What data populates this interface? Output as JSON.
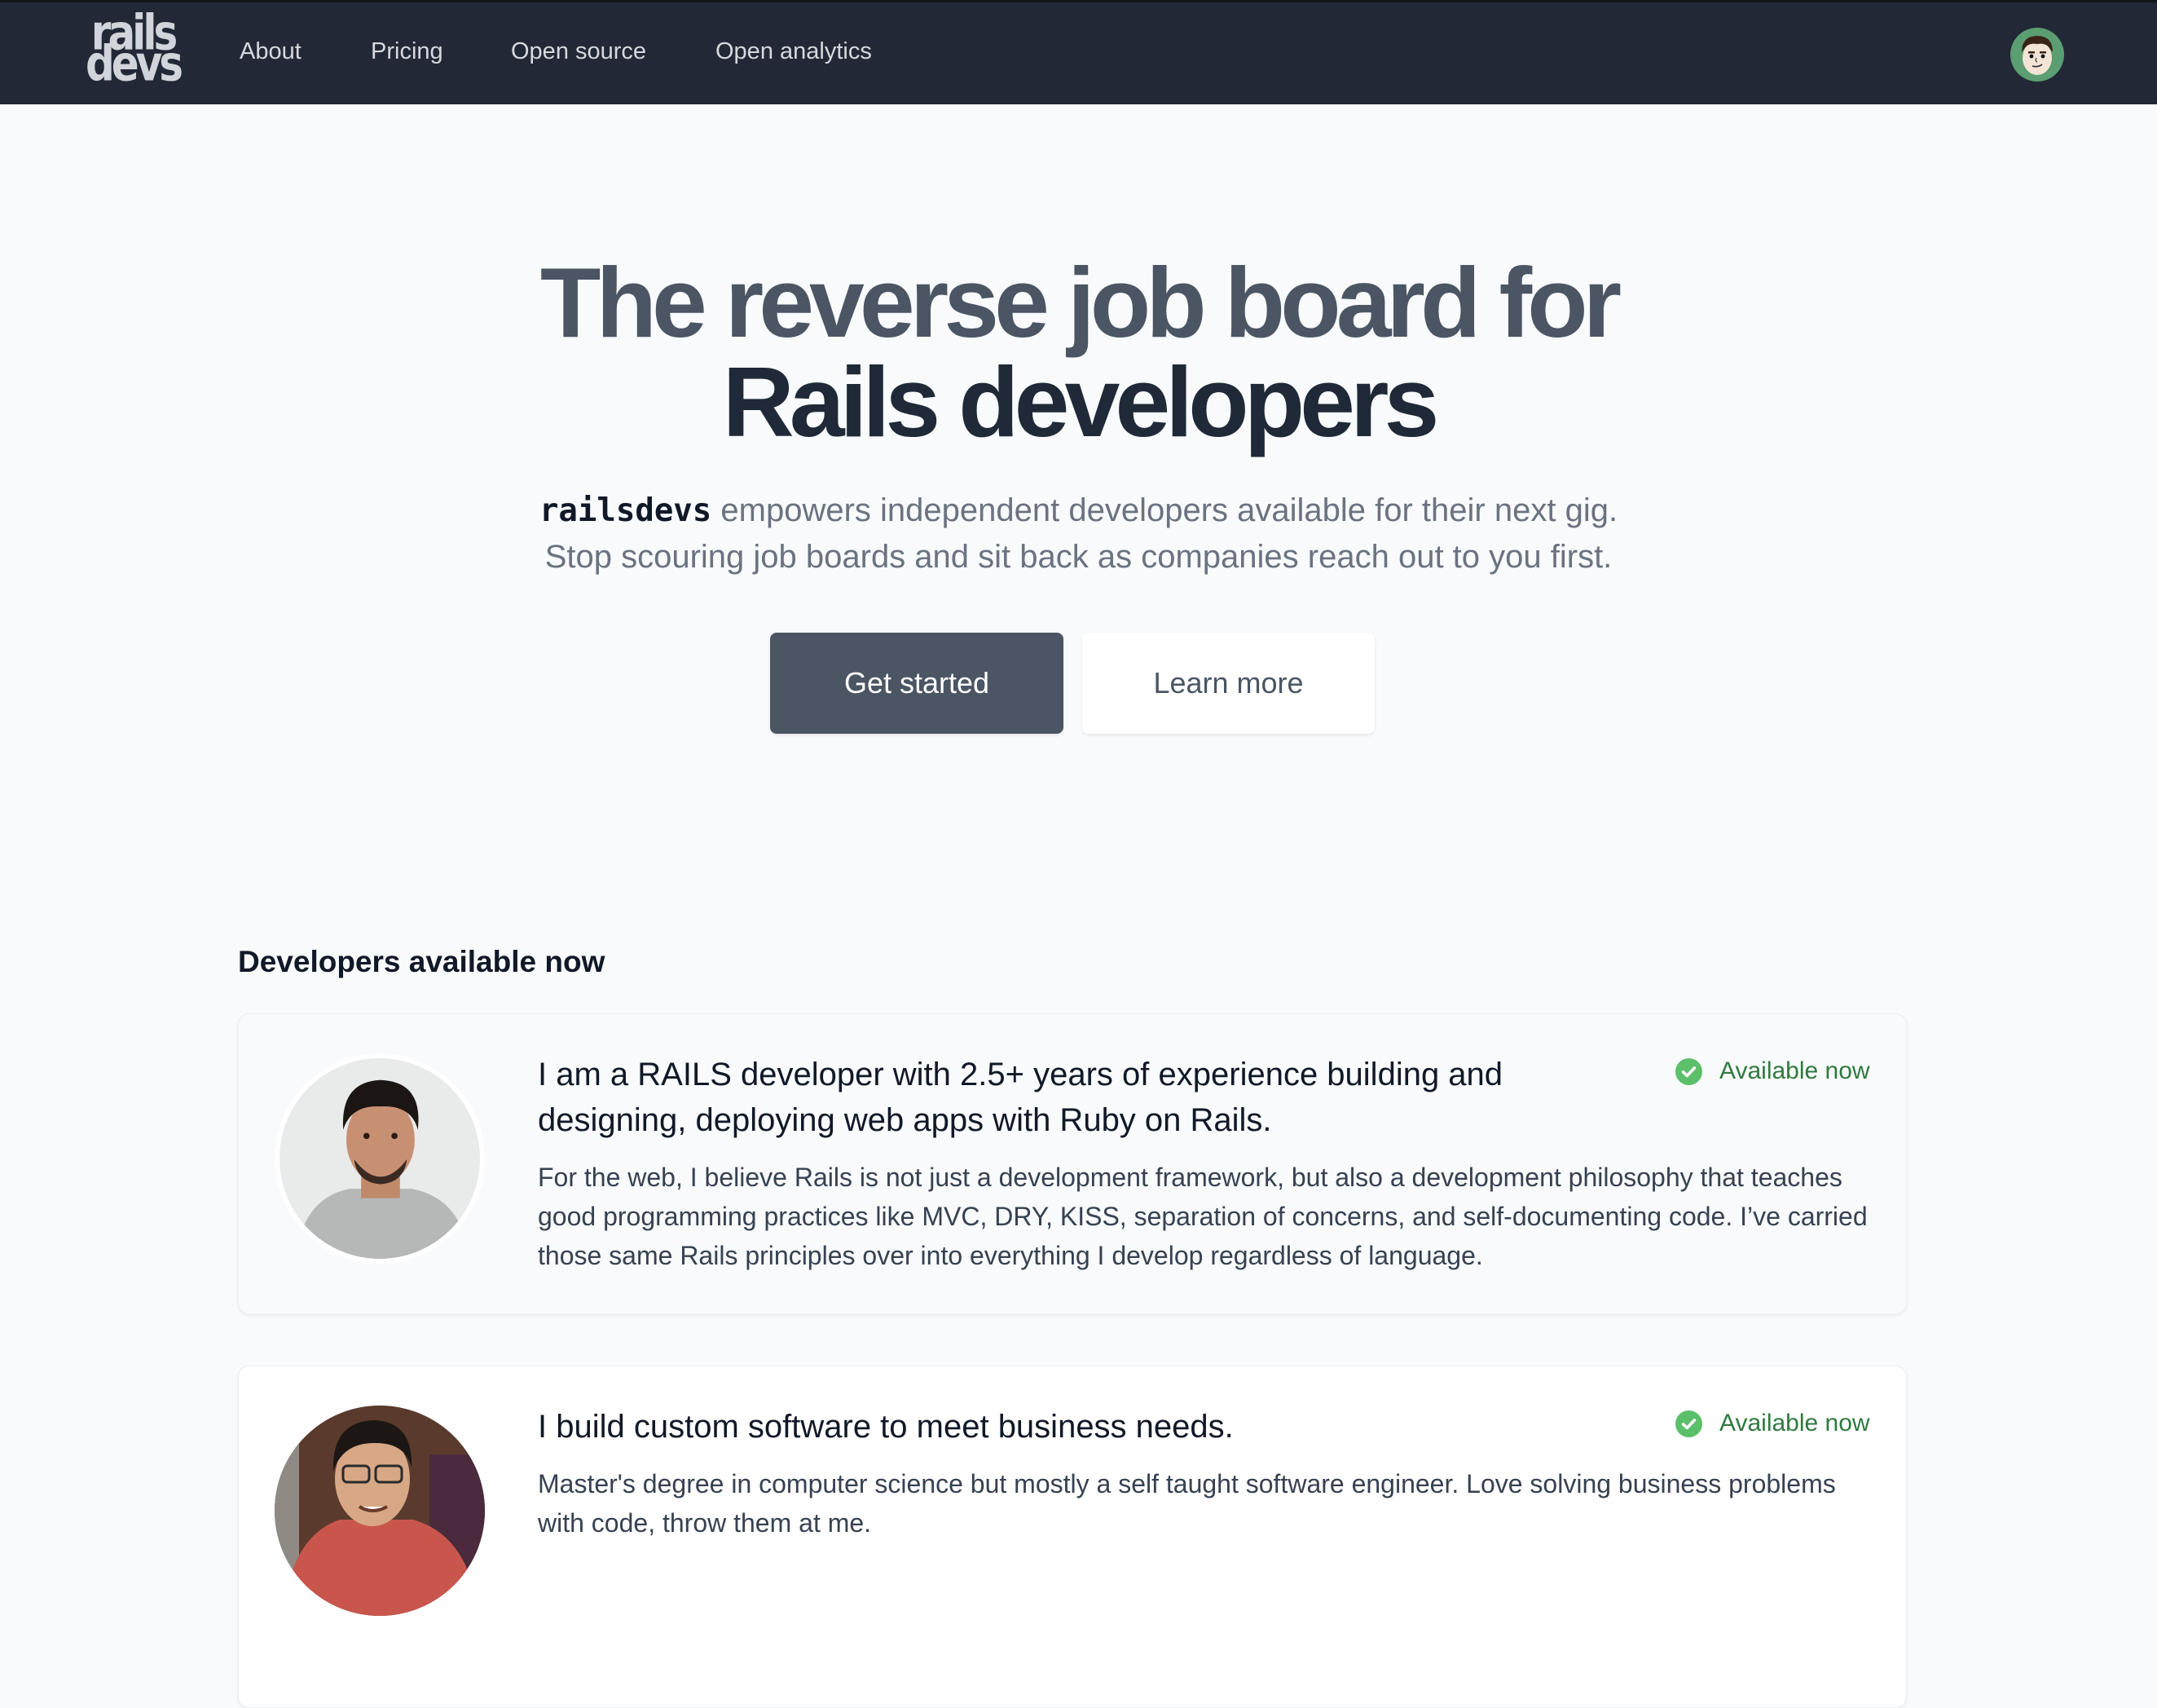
{
  "nav": {
    "logo": {
      "line1": "rails",
      "line2": "devs"
    },
    "links": [
      {
        "label": "About"
      },
      {
        "label": "Pricing"
      },
      {
        "label": "Open source"
      },
      {
        "label": "Open analytics"
      }
    ],
    "user_avatar_icon": "user-avatar-icon"
  },
  "hero": {
    "title_line1": "The reverse job board for",
    "title_line2": "Rails developers",
    "subtitle_brand": "railsdevs",
    "subtitle_line1_rest": " empowers independent developers available for their next gig.",
    "subtitle_line2": "Stop scouring job boards and sit back as companies reach out to you first.",
    "primary_button": "Get started",
    "secondary_button": "Learn more"
  },
  "developers": {
    "title": "Developers available now",
    "items": [
      {
        "headline": "I am a RAILS developer with 2.5+ years of experience building and designing, deploying web apps with Ruby on Rails.",
        "bio": "For the web, I believe Rails is not just a development framework, but also a development philosophy that teaches good programming practices like MVC, DRY, KISS, separation of concerns, and self-documenting code. I’ve carried those same Rails principles over into everything I develop regardless of language.",
        "status": "Available now",
        "status_icon": "check-circle-icon"
      },
      {
        "headline": "I build custom software to meet business needs.",
        "bio": "Master's degree in computer science but mostly a self taught software engineer. Love solving business problems with code, throw them at me.",
        "status": "Available now",
        "status_icon": "check-circle-icon"
      }
    ]
  },
  "colors": {
    "nav_bg": "#222836",
    "page_bg": "#f8fafc",
    "primary_button_bg": "#4b5563",
    "status_green": "#2f7a3e",
    "status_icon_green": "#5cbf6a"
  }
}
